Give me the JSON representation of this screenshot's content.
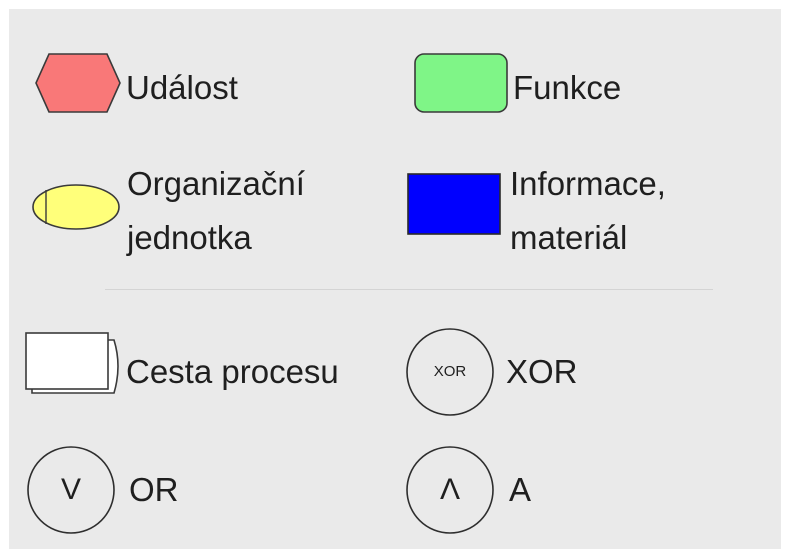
{
  "legend": {
    "event": {
      "label": "Událost",
      "icon": "hexagon-event-icon",
      "color": "#f97878"
    },
    "function": {
      "label": "Funkce",
      "icon": "rounded-rect-function-icon",
      "color": "#7ff587"
    },
    "org_unit": {
      "label_line1": "Organizační",
      "label_line2": "jednotka",
      "icon": "ellipse-org-unit-icon",
      "color": "#ffff7a"
    },
    "information": {
      "label_line1": "Informace,",
      "label_line2": "materiál",
      "icon": "rect-information-icon",
      "color": "#0000ff"
    },
    "process_path": {
      "label": "Cesta procesu",
      "icon": "stacked-pages-process-path-icon",
      "color": "#ffffff"
    },
    "xor": {
      "label": "XOR",
      "symbol": "XOR",
      "icon": "xor-connector-icon"
    },
    "or": {
      "label": "OR",
      "symbol": "V",
      "icon": "or-connector-icon"
    },
    "and": {
      "label": "A",
      "symbol": "Λ",
      "icon": "and-connector-icon"
    }
  }
}
